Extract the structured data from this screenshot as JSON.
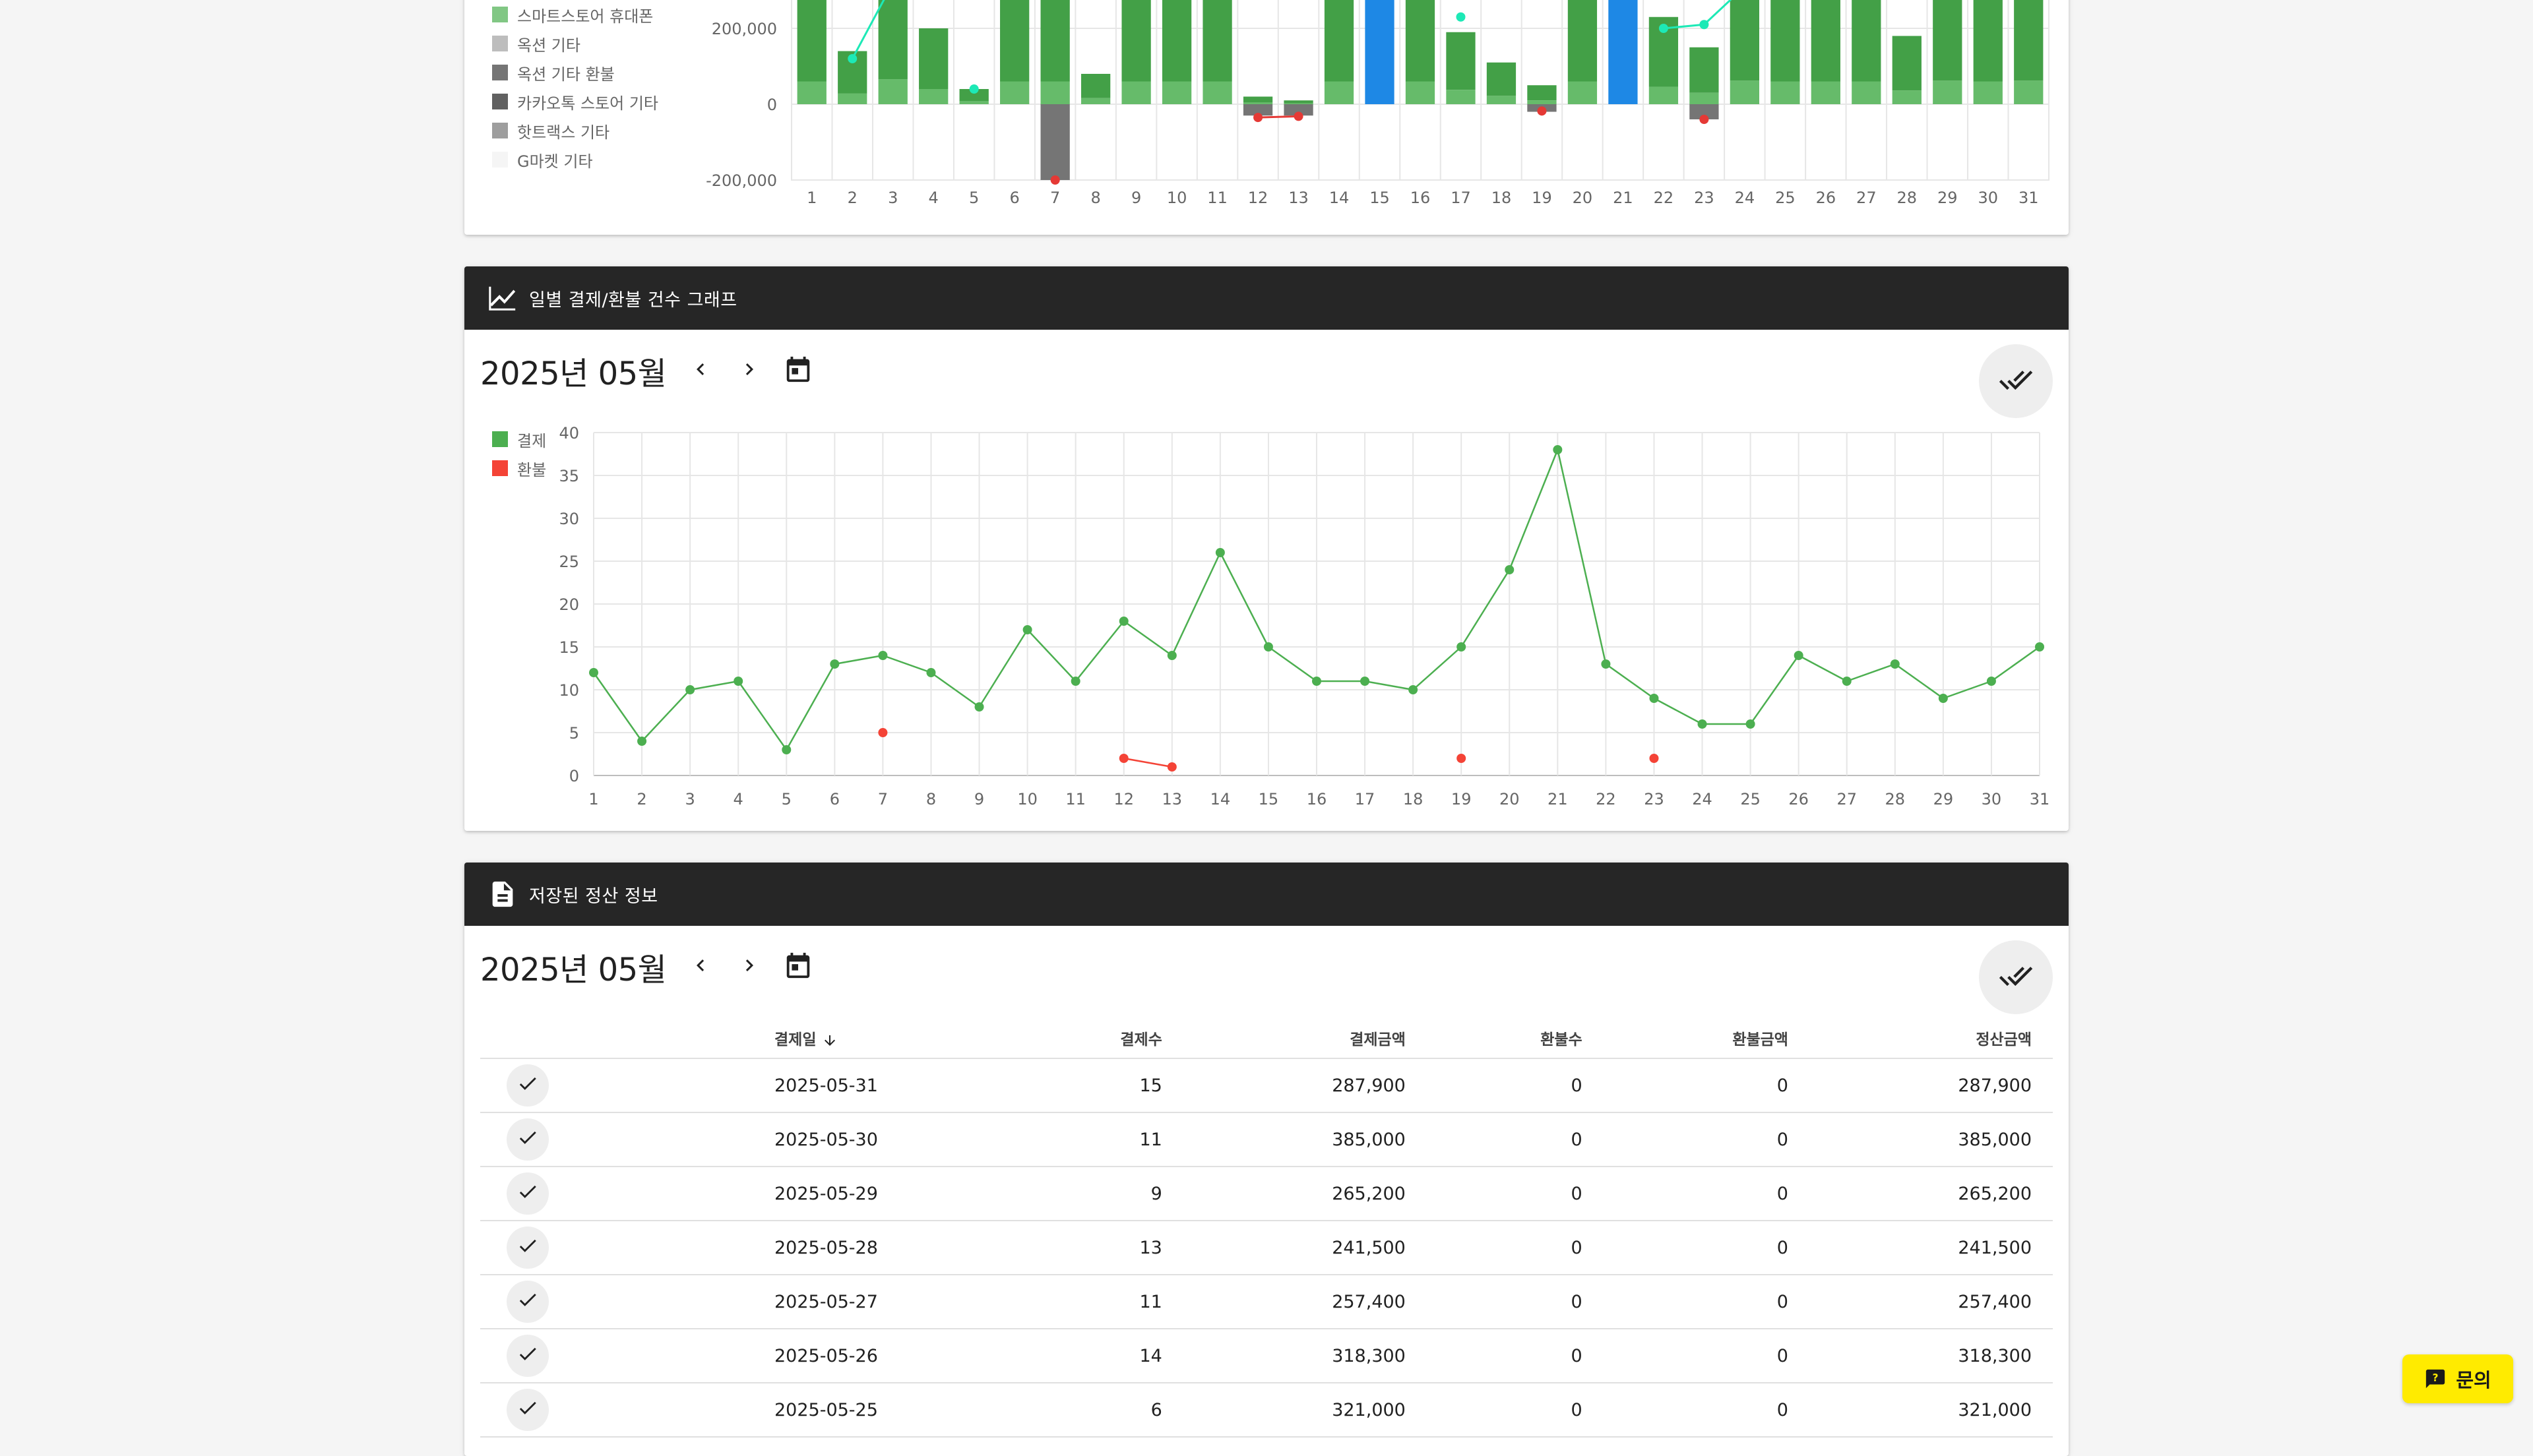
{
  "revenue_chart": {
    "legend": [
      {
        "label": "스마트스토어 휴대폰",
        "color": "#81c784"
      },
      {
        "label": "옥션 기타",
        "color": "#bdbdbd"
      },
      {
        "label": "옥션 기타 환불",
        "color": "#757575"
      },
      {
        "label": "카카오톡 스토어 기타",
        "color": "#616161"
      },
      {
        "label": "핫트랙스 기타",
        "color": "#9e9e9e"
      },
      {
        "label": "G마켓 기타",
        "color": "#f5f5f5"
      }
    ],
    "y_ticks": [
      "200,000",
      "0",
      "-200,000"
    ],
    "x_ticks": [
      "1",
      "2",
      "3",
      "4",
      "5",
      "6",
      "7",
      "8",
      "9",
      "10",
      "11",
      "12",
      "13",
      "14",
      "15",
      "16",
      "17",
      "18",
      "19",
      "20",
      "21",
      "22",
      "23",
      "24",
      "25",
      "26",
      "27",
      "28",
      "29",
      "30",
      "31"
    ],
    "chart_data": {
      "type": "bar",
      "title": "",
      "xlabel": "",
      "ylabel": "",
      "ylim": [
        -200000,
        200000
      ],
      "categories": [
        "1",
        "2",
        "3",
        "4",
        "5",
        "6",
        "7",
        "8",
        "9",
        "10",
        "11",
        "12",
        "13",
        "14",
        "15",
        "16",
        "17",
        "18",
        "19",
        "20",
        "21",
        "22",
        "23",
        "24",
        "25",
        "26",
        "27",
        "28",
        "29",
        "30",
        "31"
      ],
      "net_positive_values": [
        300000,
        140000,
        330000,
        200000,
        40000,
        300000,
        300000,
        80000,
        300000,
        300000,
        300000,
        20000,
        10000,
        300000,
        300000,
        300000,
        190000,
        110000,
        50000,
        300000,
        300000,
        230000,
        150000,
        310000,
        300000,
        300000,
        300000,
        180000,
        310000,
        300000,
        310000
      ],
      "refund_values": [
        0,
        0,
        0,
        0,
        0,
        0,
        -200000,
        0,
        0,
        0,
        0,
        -30000,
        -30000,
        0,
        0,
        0,
        0,
        0,
        -20000,
        0,
        0,
        0,
        -40000,
        0,
        0,
        0,
        0,
        0,
        0,
        0,
        0
      ],
      "line_values": [
        null,
        120000,
        320000,
        null,
        40000,
        null,
        null,
        null,
        null,
        null,
        null,
        null,
        null,
        null,
        null,
        null,
        230000,
        null,
        null,
        null,
        null,
        200000,
        210000,
        310000,
        null,
        null,
        310000,
        300000,
        310000,
        null,
        null
      ],
      "refund_line_values": [
        null,
        null,
        null,
        null,
        null,
        null,
        -200000,
        null,
        null,
        null,
        null,
        -35000,
        -32000,
        null,
        null,
        null,
        null,
        null,
        -18000,
        null,
        null,
        null,
        -40000,
        null,
        null,
        null,
        null,
        null,
        null,
        null,
        null
      ]
    }
  },
  "daily_count": {
    "header_title": "일별 결제/환불 건수 그래프",
    "month_label": "2025년 05월",
    "legend": [
      {
        "label": "결제",
        "color": "#4caf50"
      },
      {
        "label": "환불",
        "color": "#f44336"
      }
    ],
    "chart_data": {
      "type": "line",
      "title": "",
      "xlabel": "",
      "ylabel": "",
      "ylim": [
        0,
        40
      ],
      "y_ticks": [
        0,
        5,
        10,
        15,
        20,
        25,
        30,
        35,
        40
      ],
      "x": [
        1,
        2,
        3,
        4,
        5,
        6,
        7,
        8,
        9,
        10,
        11,
        12,
        13,
        14,
        15,
        16,
        17,
        18,
        19,
        20,
        21,
        22,
        23,
        24,
        25,
        26,
        27,
        28,
        29,
        30,
        31
      ],
      "series": [
        {
          "name": "결제",
          "color": "#4caf50",
          "values": [
            12,
            4,
            10,
            11,
            3,
            13,
            14,
            12,
            8,
            17,
            11,
            18,
            14,
            26,
            15,
            11,
            11,
            10,
            15,
            24,
            38,
            13,
            9,
            6,
            6,
            14,
            11,
            13,
            9,
            11,
            15
          ]
        },
        {
          "name": "환불",
          "color": "#f44336",
          "values": [
            null,
            null,
            null,
            null,
            null,
            null,
            5,
            null,
            null,
            null,
            null,
            2,
            1,
            null,
            null,
            null,
            null,
            null,
            2,
            null,
            null,
            null,
            2,
            null,
            null,
            null,
            null,
            null,
            null,
            null,
            null
          ]
        }
      ]
    }
  },
  "settlement": {
    "header_title": "저장된 정산 정보",
    "month_label": "2025년 05월",
    "columns": [
      "결제일",
      "결제수",
      "결제금액",
      "환불수",
      "환불금액",
      "정산금액"
    ],
    "rows": [
      {
        "date": "2025-05-31",
        "pay_count": "15",
        "pay_amount": "287,900",
        "refund_count": "0",
        "refund_amount": "0",
        "settle_amount": "287,900"
      },
      {
        "date": "2025-05-30",
        "pay_count": "11",
        "pay_amount": "385,000",
        "refund_count": "0",
        "refund_amount": "0",
        "settle_amount": "385,000"
      },
      {
        "date": "2025-05-29",
        "pay_count": "9",
        "pay_amount": "265,200",
        "refund_count": "0",
        "refund_amount": "0",
        "settle_amount": "265,200"
      },
      {
        "date": "2025-05-28",
        "pay_count": "13",
        "pay_amount": "241,500",
        "refund_count": "0",
        "refund_amount": "0",
        "settle_amount": "241,500"
      },
      {
        "date": "2025-05-27",
        "pay_count": "11",
        "pay_amount": "257,400",
        "refund_count": "0",
        "refund_amount": "0",
        "settle_amount": "257,400"
      },
      {
        "date": "2025-05-26",
        "pay_count": "14",
        "pay_amount": "318,300",
        "refund_count": "0",
        "refund_amount": "0",
        "settle_amount": "318,300"
      },
      {
        "date": "2025-05-25",
        "pay_count": "6",
        "pay_amount": "321,000",
        "refund_count": "0",
        "refund_amount": "0",
        "settle_amount": "321,000"
      }
    ]
  },
  "inquiry_button": {
    "label": "문의"
  }
}
